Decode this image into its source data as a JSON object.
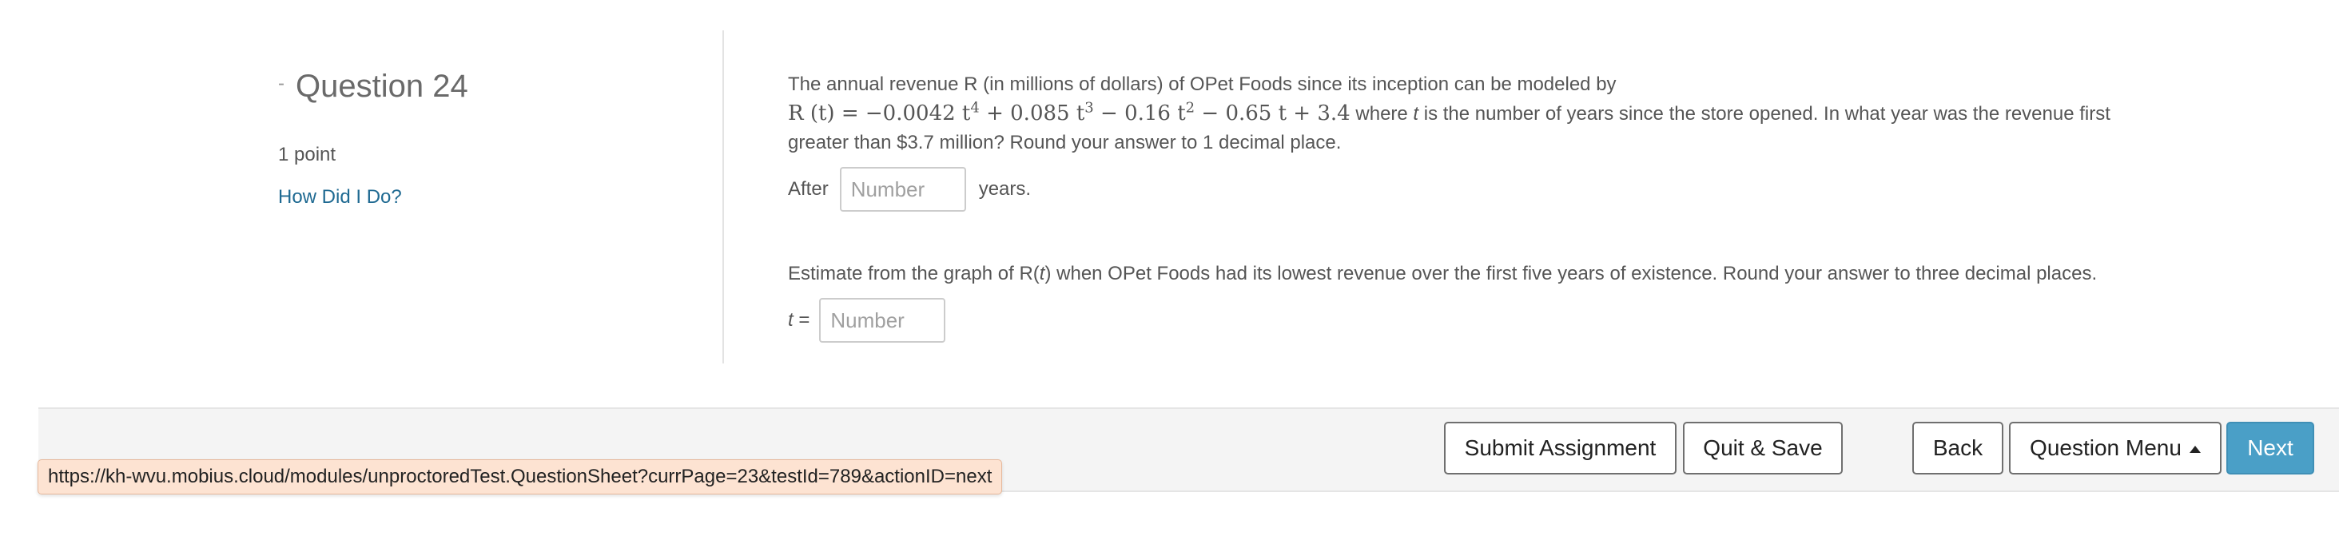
{
  "question": {
    "title": "Question 24",
    "points": "1 point",
    "how_link": "How Did I Do?"
  },
  "part1": {
    "intro": "The annual revenue R (in millions of dollars) of OPet Foods since its inception can be modeled by",
    "equation": {
      "lhs": "R (t) = ",
      "term1": "−0.0042 t",
      "exp1": "4",
      "term2": " + 0.085 t",
      "exp2": "3",
      "term3": " − 0.16 t",
      "exp3": "2",
      "term4": " − 0.65 t + 3.4"
    },
    "text_where": " where ",
    "var_t": "t",
    "text_rest": "is the number of years since the store opened. In what year was the revenue first",
    "text_line3": "greater than $3.7 million? Round your answer to 1 decimal place.",
    "answer_prefix": "After",
    "answer_suffix": "years.",
    "placeholder": "Number"
  },
  "part2": {
    "text_a": "Estimate from the graph of ",
    "func": "R(t)",
    "text_b": " when OPet Foods had its lowest revenue over the first five years of existence. Round your answer to three decimal places.",
    "answer_label_var": "t",
    "answer_label_eq": " =",
    "placeholder": "Number"
  },
  "footer": {
    "submit": "Submit Assignment",
    "quit": "Quit & Save",
    "back": "Back",
    "menu": "Question Menu",
    "next": "Next"
  },
  "status_url": "https://kh-wvu.mobius.cloud/modules/unproctoredTest.QuestionSheet?currPage=23&testId=789&actionID=next",
  "colors": {
    "link": "#1f6a92",
    "next_button": "#4a9fc7",
    "status_bg": "#fde3d2"
  }
}
